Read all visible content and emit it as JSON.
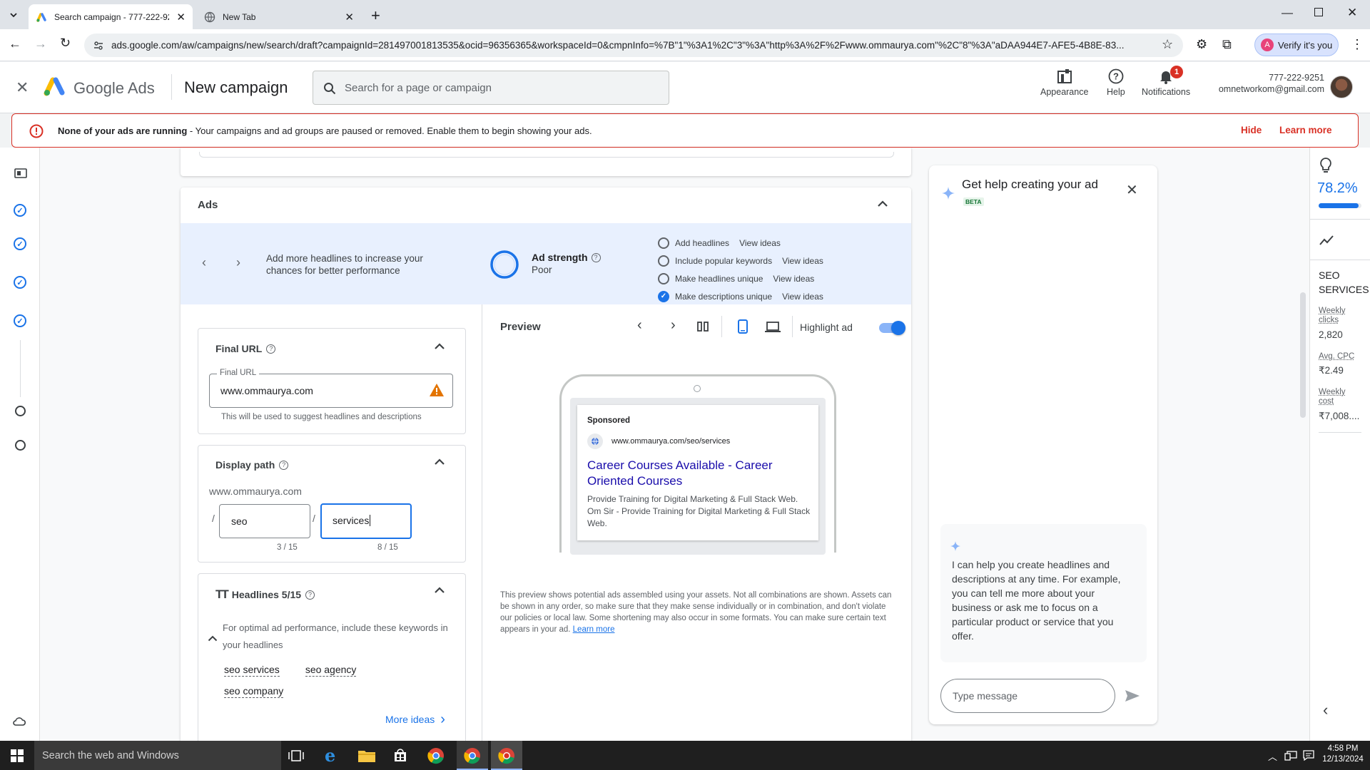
{
  "browser": {
    "tabs": [
      {
        "title": "Search campaign - 777-222-92",
        "active": true
      },
      {
        "title": "New Tab",
        "active": false
      }
    ],
    "url": "ads.google.com/aw/campaigns/new/search/draft?campaignId=281497001813535&ocid=96356365&workspaceId=0&cmpnInfo=%7B\"1\"%3A1%2C\"3\"%3A\"http%3A%2F%2Fwww.ommaurya.com\"%2C\"8\"%3A\"aDAA944E7-AFE5-4B8E-83...",
    "verify_label": "Verify it's you"
  },
  "header": {
    "product": "Google Ads",
    "page_title": "New campaign",
    "search_placeholder": "Search for a page or campaign",
    "appearance": "Appearance",
    "help": "Help",
    "notifications": "Notifications",
    "notification_count": "1",
    "account_id": "777-222-9251",
    "account_email": "omnetworkom@gmail.com"
  },
  "alert": {
    "bold": "None of your ads are running",
    "text": " - Your campaigns and ad groups are paused or removed. Enable them to begin showing your ads.",
    "hide": "Hide",
    "learn_more": "Learn more"
  },
  "ads": {
    "section_title": "Ads",
    "tip": "Add more headlines to increase your chances for better performance",
    "strength_label": "Ad strength",
    "strength_value": "Poor",
    "checklist": [
      {
        "label": "Add headlines",
        "link": "View ideas",
        "checked": false
      },
      {
        "label": "Include popular keywords",
        "link": "View ideas",
        "checked": false
      },
      {
        "label": "Make headlines unique",
        "link": "View ideas",
        "checked": false
      },
      {
        "label": "Make descriptions unique",
        "link": "View ideas",
        "checked": true
      }
    ],
    "final_url": {
      "title": "Final URL",
      "field_label": "Final URL",
      "value": "www.ommaurya.com",
      "hint": "This will be used to suggest headlines and descriptions"
    },
    "display_path": {
      "title": "Display path",
      "domain": "www.ommaurya.com",
      "path1": "seo",
      "path1_count": "3 / 15",
      "path2": "services",
      "path2_count": "8 / 15"
    },
    "headlines": {
      "title": "Headlines 5/15",
      "tip": "For optimal ad performance, include these keywords in your headlines",
      "keywords": [
        "seo services",
        "seo agency",
        "seo company"
      ],
      "more_ideas": "More ideas"
    },
    "preview": {
      "title": "Preview",
      "highlight_label": "Highlight ad",
      "sponsored": "Sponsored",
      "display_url": "www.ommaurya.com/seo/services",
      "headline": "Career Courses Available - Career Oriented Courses",
      "description": "Provide Training for Digital Marketing & Full Stack Web. Om Sir - Provide Training for Digital Marketing & Full Stack Web.",
      "disclaimer": "This preview shows potential ads assembled using your assets. Not all combinations are shown. Assets can be shown in any order, so make sure that they make sense individually or in combination, and don't violate our policies or local law. Some shortening may also occur in some formats. You can make sure certain text appears in your ad.",
      "learn_more": "Learn more"
    }
  },
  "assistant": {
    "title": "Get help creating your ad",
    "badge": "BETA",
    "message": "I can help you create headlines and descriptions at any time. For example, you can tell me more about your business or ask me to focus on a particular product or service that you offer.",
    "input_placeholder": "Type message"
  },
  "insights": {
    "score": "78.2%",
    "score_fraction": 0.93,
    "campaign_name": "SEO SERVICES",
    "metrics": [
      {
        "label": "Weekly clicks",
        "value": "2,820"
      },
      {
        "label": "Avg. CPC",
        "value": "₹2.49"
      },
      {
        "label": "Weekly cost",
        "value": "₹7,008...."
      }
    ]
  },
  "taskbar": {
    "search_placeholder": "Search the web and Windows",
    "time": "4:58 PM",
    "date": "12/13/2024"
  },
  "colors": {
    "accent": "#1a73e8",
    "error": "#d93025",
    "warning": "#e37400"
  }
}
